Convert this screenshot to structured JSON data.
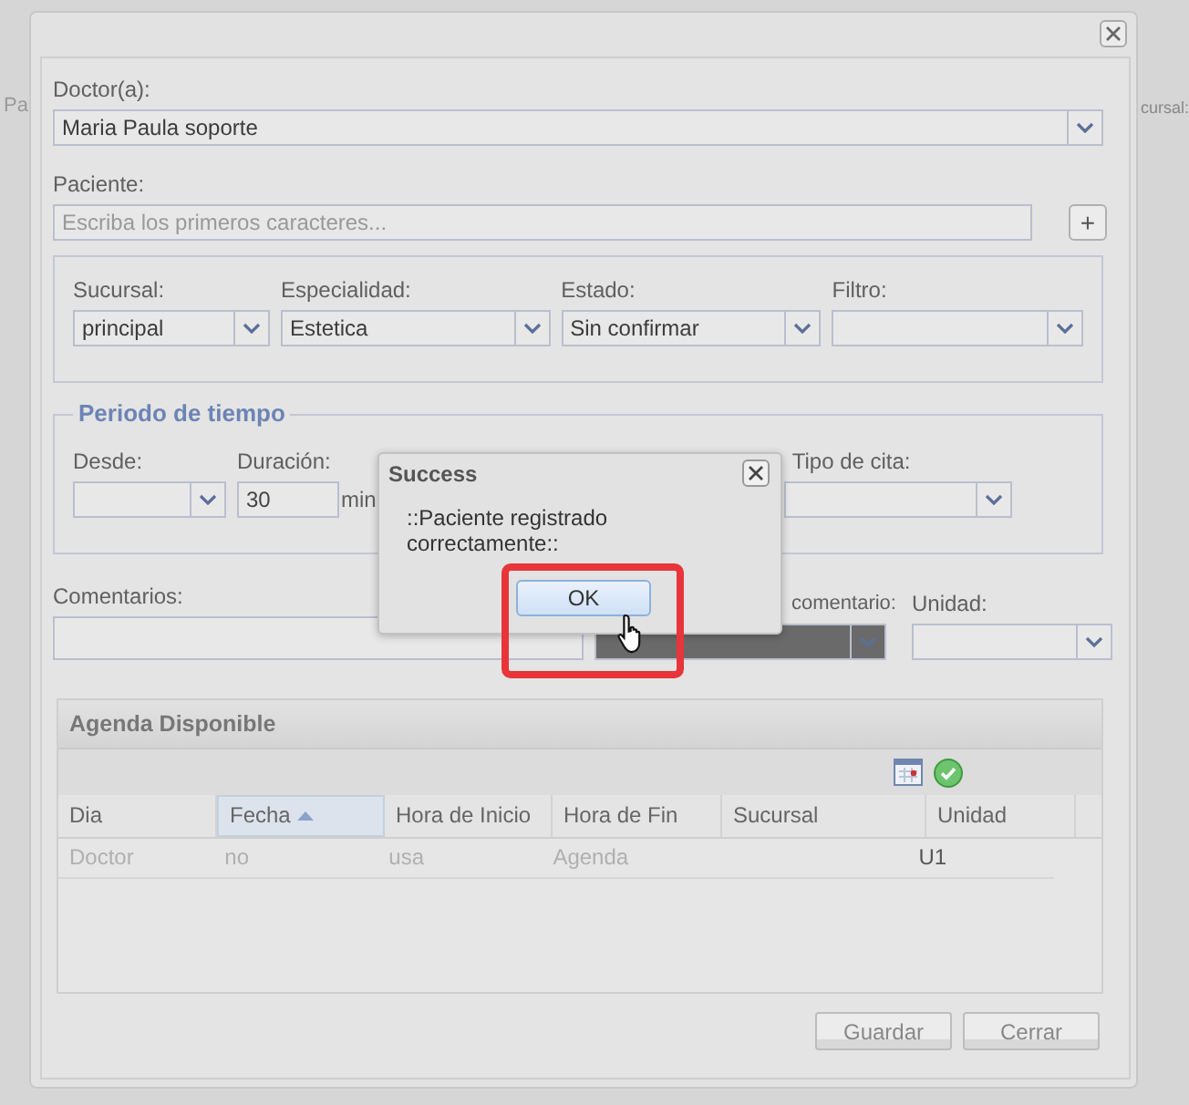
{
  "background": {
    "left_label": "Pa",
    "right_label": "cursal:"
  },
  "form": {
    "doctor": {
      "label": "Doctor(a):",
      "value": "Maria Paula soporte"
    },
    "patient": {
      "label": "Paciente:",
      "placeholder": "Escriba los primeros caracteres...",
      "add_button": "+"
    },
    "filters": [
      {
        "label": "Sucursal:",
        "value": "principal"
      },
      {
        "label": "Especialidad:",
        "value": "Estetica"
      },
      {
        "label": "Estado:",
        "value": "Sin confirmar"
      },
      {
        "label": "Filtro:"
      }
    ],
    "time_period": {
      "legend": "Periodo de tiempo",
      "from_label": "Desde:",
      "duration_label": "Duración:",
      "duration_value": "30",
      "duration_unit": "min",
      "type_label": "Tipo de cita:"
    },
    "comments": {
      "label": "Comentarios:"
    },
    "color_label": "comentario:",
    "unit_label": "Unidad:"
  },
  "agenda": {
    "title": "Agenda Disponible",
    "columns": [
      {
        "label": "Dia",
        "sorted": false
      },
      {
        "label": "Fecha",
        "sorted": true
      },
      {
        "label": "Hora de Inicio",
        "sorted": false
      },
      {
        "label": "Hora de Fin",
        "sorted": false
      },
      {
        "label": "Sucursal",
        "sorted": false
      },
      {
        "label": "Unidad",
        "sorted": false
      }
    ],
    "rows": [
      {
        "cells": [
          {
            "text": "Doctor",
            "muted": true
          },
          {
            "text": "no",
            "muted": true
          },
          {
            "text": "usa",
            "muted": true
          },
          {
            "text": "Agenda",
            "muted": true
          },
          null,
          {
            "text": "U1",
            "muted": false
          }
        ]
      }
    ]
  },
  "buttons": [
    "Guardar",
    "Cerrar"
  ],
  "dialog": {
    "title": "Success",
    "message": "::Paciente registrado correctamente::",
    "ok": "OK",
    "highlighted": true
  }
}
